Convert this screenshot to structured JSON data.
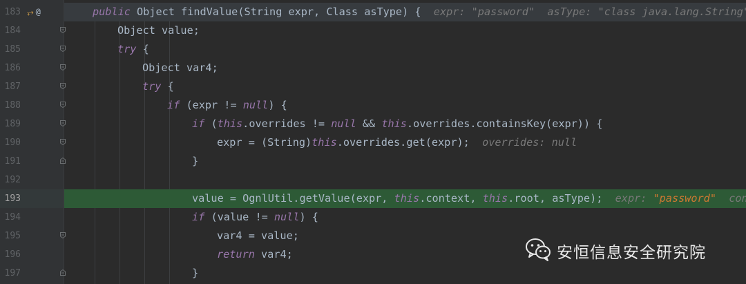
{
  "editor": {
    "lines": [
      {
        "num": "183",
        "segments": [
          [
            "kw2",
            "public"
          ],
          [
            "pl",
            " Object "
          ],
          [
            "pl",
            "findValue"
          ],
          [
            "pl",
            "(String expr, Class asType) {"
          ],
          [
            "sp",
            "  "
          ],
          [
            "hint",
            "expr: \"password\""
          ],
          [
            "sp",
            "  "
          ],
          [
            "hint",
            "asType: \"class java.lang.String\""
          ]
        ]
      },
      {
        "num": "184",
        "segments": [
          [
            "pl",
            "Object value;"
          ]
        ]
      },
      {
        "num": "185",
        "segments": [
          [
            "kw2",
            "try"
          ],
          [
            "pl",
            " {"
          ]
        ]
      },
      {
        "num": "186",
        "segments": [
          [
            "pl",
            "Object var4;"
          ]
        ]
      },
      {
        "num": "187",
        "segments": [
          [
            "kw2",
            "try"
          ],
          [
            "pl",
            " {"
          ]
        ]
      },
      {
        "num": "188",
        "segments": [
          [
            "kw2",
            "if"
          ],
          [
            "pl",
            " (expr != "
          ],
          [
            "kw2",
            "null"
          ],
          [
            "pl",
            ") {"
          ]
        ]
      },
      {
        "num": "189",
        "segments": [
          [
            "kw2",
            "if"
          ],
          [
            "pl",
            " ("
          ],
          [
            "kw2",
            "this"
          ],
          [
            "pl",
            ".overrides != "
          ],
          [
            "kw2",
            "null"
          ],
          [
            "pl",
            " && "
          ],
          [
            "kw2",
            "this"
          ],
          [
            "pl",
            ".overrides.containsKey(expr)) {"
          ]
        ]
      },
      {
        "num": "190",
        "segments": [
          [
            "pl",
            "expr = (String)"
          ],
          [
            "kw2",
            "this"
          ],
          [
            "pl",
            ".overrides.get(expr);"
          ],
          [
            "sp",
            "  "
          ],
          [
            "hint",
            "overrides: null"
          ]
        ]
      },
      {
        "num": "191",
        "segments": [
          [
            "pl",
            "}"
          ]
        ]
      },
      {
        "num": "192",
        "segments": []
      },
      {
        "num": "193",
        "segments": [
          [
            "pl",
            "value = OgnlUtil.getValue(expr, "
          ],
          [
            "kw2",
            "this"
          ],
          [
            "pl",
            ".context, "
          ],
          [
            "kw2",
            "this"
          ],
          [
            "pl",
            ".root, asType);"
          ],
          [
            "sp",
            "  "
          ],
          [
            "hint",
            "expr: "
          ],
          [
            "hintstr",
            "\"password\""
          ],
          [
            "sp",
            "  "
          ],
          [
            "hint",
            "conte"
          ]
        ]
      },
      {
        "num": "194",
        "segments": [
          [
            "kw2",
            "if"
          ],
          [
            "pl",
            " (value != "
          ],
          [
            "kw2",
            "null"
          ],
          [
            "pl",
            ") {"
          ]
        ]
      },
      {
        "num": "195",
        "segments": [
          [
            "pl",
            "var4 = value;"
          ]
        ]
      },
      {
        "num": "196",
        "segments": [
          [
            "kw2",
            "return"
          ],
          [
            "pl",
            " var4;"
          ]
        ]
      },
      {
        "num": "197",
        "segments": [
          [
            "pl",
            "}"
          ]
        ]
      }
    ],
    "gutter_icons": [
      "override-icon",
      "annotation-icon"
    ],
    "gutter_icon_glyphs": [
      "⥅",
      "@"
    ]
  },
  "watermark": {
    "text": "安恒信息安全研究院",
    "icon": "wechat-icon"
  },
  "colors": {
    "background": "#2b2b2b",
    "gutter": "#313335",
    "keyword": "#9876aa",
    "plain": "#a9b7c6",
    "hint": "#787878",
    "hint_string": "#cc7832",
    "exec_line": "#2d5a36",
    "header_line": "#373b3f"
  }
}
